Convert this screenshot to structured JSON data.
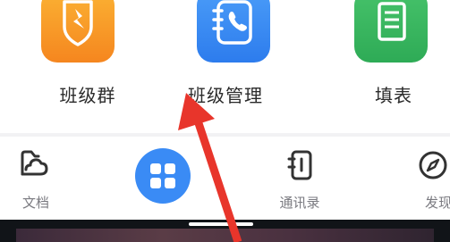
{
  "apps": [
    {
      "id": "class-group",
      "label": "班级群",
      "icon": "class-group-icon",
      "color_from": "#fbb233",
      "color_to": "#f58a1f"
    },
    {
      "id": "class-management",
      "label": "班级管理",
      "icon": "contact-book-icon",
      "color_from": "#4a9cf8",
      "color_to": "#2f7ef1"
    },
    {
      "id": "fill-form",
      "label": "填表",
      "icon": "form-icon",
      "color_from": "#46c26a",
      "color_to": "#2eab56"
    }
  ],
  "dock": {
    "items": [
      {
        "id": "documents",
        "label": "文档",
        "icon": "cloud-folder-icon"
      },
      {
        "id": "apps",
        "label": "",
        "icon": "grid-icon"
      },
      {
        "id": "contacts",
        "label": "通讯录",
        "icon": "contact-book-icon"
      },
      {
        "id": "discover",
        "label": "发现",
        "icon": "compass-icon"
      }
    ]
  },
  "colors": {
    "accent_blue": "#3a8bf5",
    "annotation_arrow": "#e8352b"
  }
}
